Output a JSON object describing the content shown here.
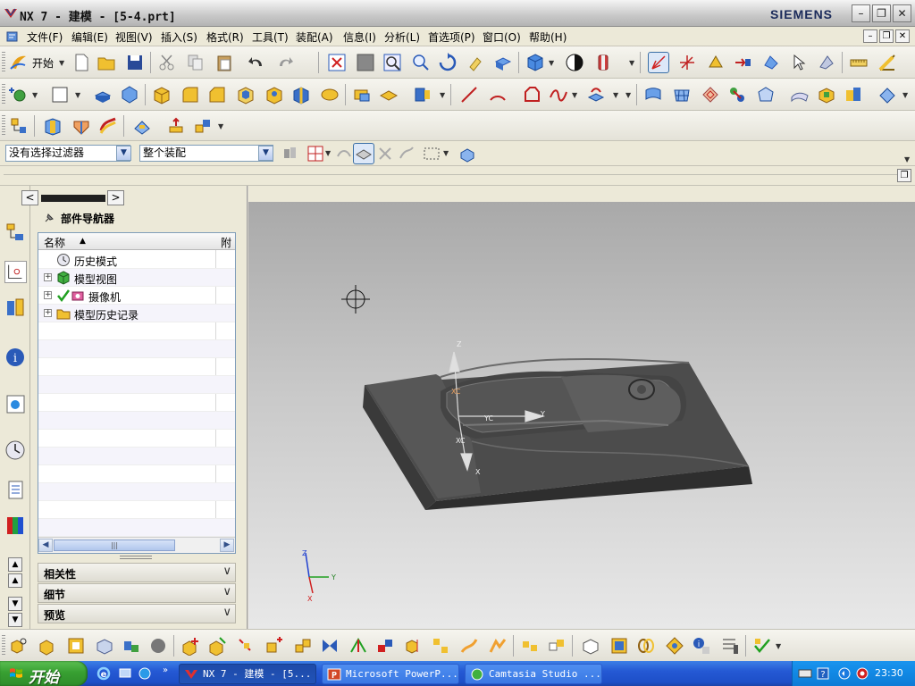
{
  "window": {
    "title": "NX 7 - 建模 - [5-4.prt]",
    "brand": "SIEMENS"
  },
  "menu": {
    "items": [
      "文件(F)",
      "编辑(E)",
      "视图(V)",
      "插入(S)",
      "格式(R)",
      "工具(T)",
      "装配(A)",
      "信息(I)",
      "分析(L)",
      "首选项(P)",
      "窗口(O)",
      "帮助(H)"
    ]
  },
  "toolbar": {
    "start_label": "开始"
  },
  "selection": {
    "filter_value": "没有选择过滤器",
    "scope_value": "整个装配"
  },
  "navigator": {
    "title": "部件导航器",
    "col_name": "名称",
    "col_attach": "附",
    "rows": [
      {
        "label": "历史模式",
        "icon": "clock-icon",
        "expandable": false
      },
      {
        "label": "模型视图",
        "icon": "model-view-icon",
        "expandable": true
      },
      {
        "label": "摄像机",
        "icon": "camera-icon",
        "expandable": true,
        "checked": true
      },
      {
        "label": "模型历史记录",
        "icon": "folder-icon",
        "expandable": true
      }
    ],
    "sections": [
      "相关性",
      "细节",
      "预览"
    ]
  },
  "viewport": {
    "axis_labels": {
      "z": "Z",
      "xc": "XC",
      "yc": "YC",
      "y": "Y",
      "x": "X"
    },
    "triad_labels": {
      "z": "Z",
      "y": "Y",
      "x": "X"
    }
  },
  "taskbar": {
    "start": "开始",
    "tasks": [
      {
        "label": "NX 7 - 建模 - [5...",
        "active": true
      },
      {
        "label": "Microsoft PowerP...",
        "active": false
      },
      {
        "label": "Camtasia Studio ...",
        "active": false
      }
    ],
    "clock": "23:30"
  },
  "colors": {
    "accent": "#2559d4",
    "brand": "#1a2a5a",
    "model_gray": "#5a5a5a"
  }
}
